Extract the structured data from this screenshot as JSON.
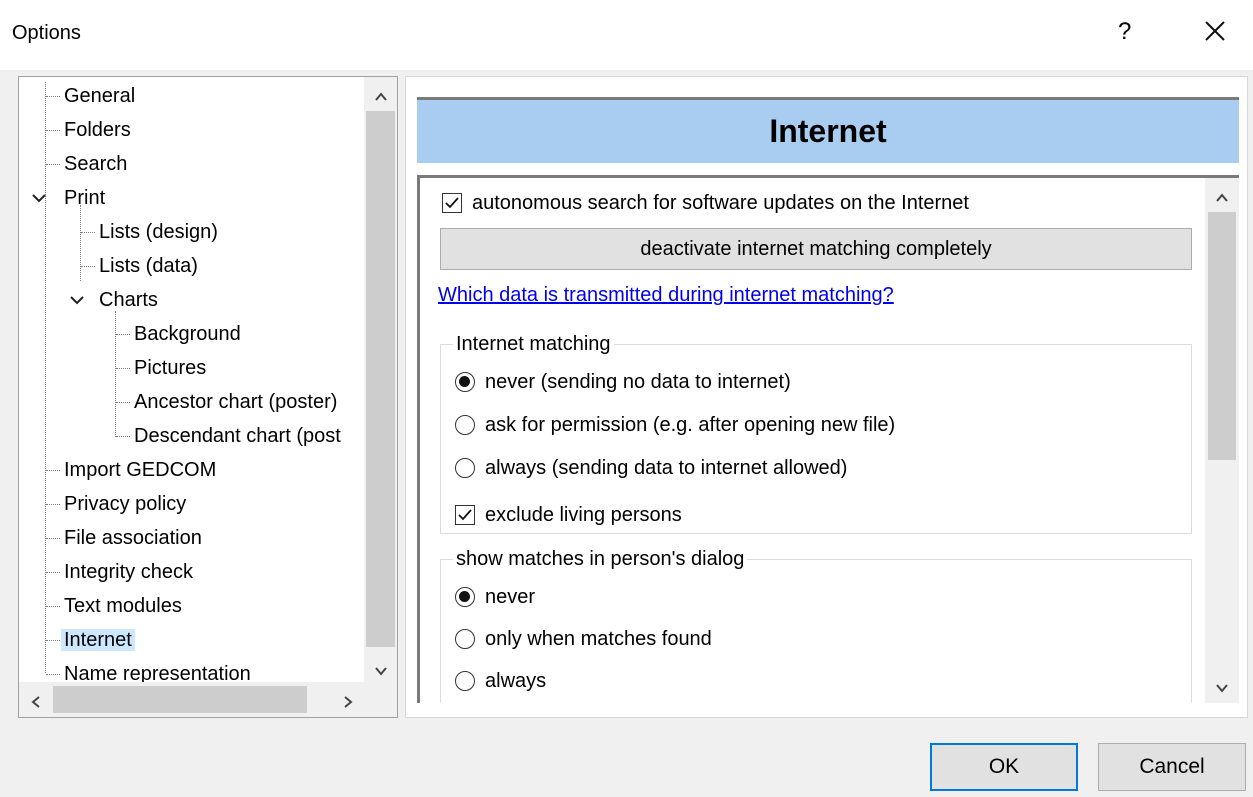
{
  "window": {
    "title": "Options",
    "help_label": "?"
  },
  "tree": {
    "items": [
      {
        "label": "General"
      },
      {
        "label": "Folders"
      },
      {
        "label": "Search"
      },
      {
        "label": "Print"
      },
      {
        "label": "Lists (design)"
      },
      {
        "label": "Lists (data)"
      },
      {
        "label": "Charts"
      },
      {
        "label": "Background"
      },
      {
        "label": "Pictures"
      },
      {
        "label": "Ancestor chart (poster)"
      },
      {
        "label": "Descendant chart (post"
      },
      {
        "label": "Import GEDCOM"
      },
      {
        "label": "Privacy policy"
      },
      {
        "label": "File association"
      },
      {
        "label": "Integrity check"
      },
      {
        "label": "Text modules"
      },
      {
        "label": "Internet"
      },
      {
        "label": "Name representation"
      }
    ],
    "selected": "Internet"
  },
  "panel": {
    "header": "Internet",
    "auto_update": {
      "label": "autonomous search for software updates on the Internet",
      "checked": true
    },
    "deactivate_button": "deactivate internet matching completely",
    "info_link": "Which data is transmitted during internet matching?",
    "internet_matching": {
      "legend": "Internet matching",
      "options": [
        {
          "label": "never (sending no data to internet)",
          "selected": true
        },
        {
          "label": "ask for permission (e.g. after opening new file)",
          "selected": false
        },
        {
          "label": "always (sending data to internet allowed)",
          "selected": false
        }
      ],
      "exclude_living": {
        "label": "exclude living persons",
        "checked": true
      }
    },
    "show_matches": {
      "legend": "show matches in person's dialog",
      "options": [
        {
          "label": "never",
          "selected": true
        },
        {
          "label": "only when matches found",
          "selected": false
        },
        {
          "label": "always",
          "selected": false
        }
      ]
    }
  },
  "buttons": {
    "ok": "OK",
    "cancel": "Cancel"
  }
}
